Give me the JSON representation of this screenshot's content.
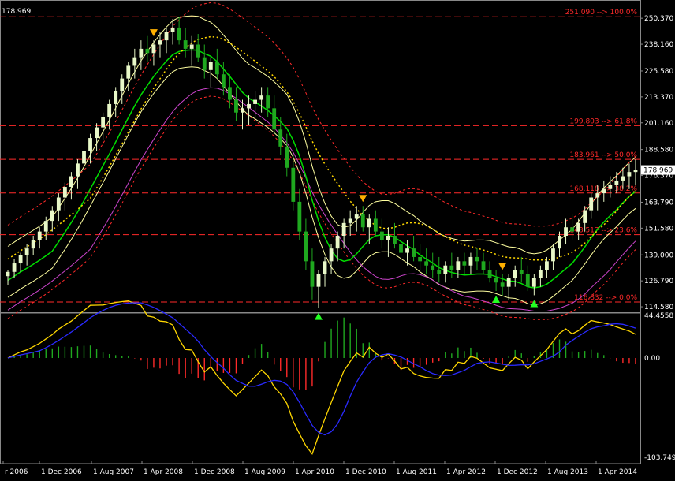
{
  "chart_data": {
    "type": "candlestick",
    "price_axis": {
      "ticks": [
        "250.370",
        "238.160",
        "225.580",
        "213.370",
        "201.160",
        "188.580",
        "176.370",
        "163.790",
        "151.580",
        "139.000",
        "126.790",
        "114.580"
      ],
      "current_price": "178.969",
      "corner_price": "178.969"
    },
    "oscillator_axis": {
      "ticks": [
        "44.4558",
        "0.00",
        "-103.7492"
      ]
    },
    "x_ticks": [
      "r 2006",
      "1 Dec 2006",
      "1 Aug 2007",
      "1 Apr 2008",
      "1 Dec 2008",
      "1 Aug 2009",
      "1 Apr 2010",
      "1 Dec 2010",
      "1 Aug 2011",
      "1 Apr 2012",
      "1 Dec 2012",
      "1 Aug 2013",
      "1 Apr 2014"
    ],
    "fibonacci_levels": [
      {
        "label": "251.090 --> 100.0%",
        "price": 251.09
      },
      {
        "label": "199.803 --> 61.8%",
        "price": 199.803
      },
      {
        "label": "183.961 --> 50.0%",
        "price": 183.961
      },
      {
        "label": "168.118 --> 38.2%",
        "price": 168.118
      },
      {
        "label": "148.517 --> 23.6%",
        "price": 148.517
      },
      {
        "label": "116.832 --> 0.0%",
        "price": 116.832
      }
    ],
    "price_series": [
      [
        0,
        129,
        132,
        125,
        131
      ],
      [
        1,
        131,
        137,
        128,
        135
      ],
      [
        2,
        135,
        140,
        131,
        139
      ],
      [
        3,
        139,
        144,
        134,
        142
      ],
      [
        4,
        142,
        148,
        139,
        146
      ],
      [
        5,
        146,
        152,
        142,
        150
      ],
      [
        6,
        150,
        157,
        146,
        155
      ],
      [
        7,
        155,
        162,
        150,
        160
      ],
      [
        8,
        160,
        168,
        155,
        166
      ],
      [
        9,
        166,
        173,
        160,
        171
      ],
      [
        10,
        171,
        178,
        165,
        176
      ],
      [
        11,
        176,
        184,
        170,
        182
      ],
      [
        12,
        182,
        190,
        176,
        188
      ],
      [
        13,
        188,
        196,
        182,
        194
      ],
      [
        14,
        194,
        201,
        188,
        199
      ],
      [
        15,
        199,
        206,
        193,
        204
      ],
      [
        16,
        204,
        212,
        198,
        210
      ],
      [
        17,
        210,
        218,
        204,
        216
      ],
      [
        18,
        216,
        224,
        210,
        222
      ],
      [
        19,
        222,
        230,
        216,
        228
      ],
      [
        20,
        228,
        236,
        222,
        232
      ],
      [
        21,
        232,
        240,
        226,
        236
      ],
      [
        22,
        236,
        242,
        230,
        234
      ],
      [
        23,
        234,
        240,
        228,
        238
      ],
      [
        24,
        238,
        244,
        232,
        240
      ],
      [
        25,
        240,
        246,
        234,
        244
      ],
      [
        26,
        244,
        250,
        238,
        246
      ],
      [
        27,
        246,
        251,
        238,
        240
      ],
      [
        28,
        240,
        246,
        232,
        236
      ],
      [
        29,
        236,
        242,
        228,
        238
      ],
      [
        30,
        238,
        243,
        230,
        232
      ],
      [
        31,
        232,
        238,
        222,
        226
      ],
      [
        32,
        226,
        232,
        218,
        230
      ],
      [
        33,
        230,
        236,
        222,
        224
      ],
      [
        34,
        224,
        230,
        214,
        218
      ],
      [
        35,
        218,
        224,
        208,
        212
      ],
      [
        36,
        212,
        218,
        202,
        206
      ],
      [
        37,
        206,
        212,
        198,
        208
      ],
      [
        38,
        208,
        214,
        200,
        210
      ],
      [
        39,
        210,
        216,
        204,
        212
      ],
      [
        40,
        212,
        218,
        206,
        214
      ],
      [
        41,
        214,
        218,
        204,
        208
      ],
      [
        42,
        208,
        214,
        196,
        198
      ],
      [
        43,
        198,
        204,
        186,
        190
      ],
      [
        44,
        190,
        196,
        176,
        180
      ],
      [
        45,
        180,
        186,
        160,
        164
      ],
      [
        46,
        164,
        170,
        146,
        150
      ],
      [
        47,
        150,
        156,
        132,
        136
      ],
      [
        48,
        136,
        142,
        118,
        124
      ],
      [
        49,
        124,
        132,
        114,
        130
      ],
      [
        50,
        130,
        138,
        124,
        136
      ],
      [
        51,
        136,
        144,
        130,
        142
      ],
      [
        52,
        142,
        150,
        136,
        148
      ],
      [
        53,
        148,
        156,
        142,
        154
      ],
      [
        54,
        154,
        160,
        148,
        156
      ],
      [
        55,
        156,
        162,
        150,
        158
      ],
      [
        56,
        158,
        162,
        150,
        152
      ],
      [
        57,
        152,
        158,
        144,
        156
      ],
      [
        58,
        156,
        160,
        148,
        150
      ],
      [
        59,
        150,
        156,
        142,
        146
      ],
      [
        60,
        146,
        152,
        138,
        148
      ],
      [
        61,
        148,
        154,
        142,
        144
      ],
      [
        62,
        144,
        150,
        136,
        140
      ],
      [
        63,
        140,
        146,
        134,
        142
      ],
      [
        64,
        142,
        148,
        136,
        138
      ],
      [
        65,
        138,
        144,
        132,
        136
      ],
      [
        66,
        136,
        142,
        130,
        134
      ],
      [
        67,
        134,
        140,
        128,
        132
      ],
      [
        68,
        132,
        138,
        126,
        130
      ],
      [
        69,
        130,
        136,
        126,
        134
      ],
      [
        70,
        134,
        140,
        128,
        132
      ],
      [
        71,
        132,
        138,
        128,
        136
      ],
      [
        72,
        136,
        140,
        130,
        134
      ],
      [
        73,
        134,
        140,
        130,
        138
      ],
      [
        74,
        138,
        142,
        132,
        136
      ],
      [
        75,
        136,
        140,
        130,
        132
      ],
      [
        76,
        132,
        136,
        126,
        128
      ],
      [
        77,
        128,
        132,
        122,
        126
      ],
      [
        78,
        126,
        130,
        120,
        124
      ],
      [
        79,
        124,
        130,
        118,
        128
      ],
      [
        80,
        128,
        134,
        124,
        132
      ],
      [
        81,
        132,
        138,
        126,
        130
      ],
      [
        82,
        130,
        134,
        122,
        124
      ],
      [
        83,
        124,
        130,
        120,
        128
      ],
      [
        84,
        128,
        134,
        124,
        132
      ],
      [
        85,
        132,
        138,
        128,
        136
      ],
      [
        86,
        136,
        144,
        132,
        142
      ],
      [
        87,
        142,
        150,
        138,
        148
      ],
      [
        88,
        148,
        156,
        144,
        152
      ],
      [
        89,
        152,
        158,
        146,
        150
      ],
      [
        90,
        150,
        156,
        146,
        154
      ],
      [
        91,
        154,
        162,
        150,
        160
      ],
      [
        92,
        160,
        168,
        156,
        166
      ],
      [
        93,
        166,
        172,
        160,
        168
      ],
      [
        94,
        168,
        174,
        164,
        170
      ],
      [
        95,
        170,
        176,
        166,
        172
      ],
      [
        96,
        172,
        178,
        168,
        174
      ],
      [
        97,
        174,
        180,
        170,
        176
      ],
      [
        98,
        176,
        182,
        170,
        178
      ],
      [
        99,
        178,
        184,
        172,
        179
      ]
    ],
    "signals": [
      {
        "type": "down",
        "index": 23
      },
      {
        "type": "down",
        "index": 56
      },
      {
        "type": "down",
        "index": 78
      },
      {
        "type": "up",
        "index": 49
      },
      {
        "type": "up",
        "index": 77
      },
      {
        "type": "up",
        "index": 83
      }
    ],
    "colors": {
      "background": "#000000",
      "bull": "#e8f8c8",
      "bear": "#1fa81f",
      "grid": "#333333",
      "fib": "#ff2a2a",
      "ma_green": "#00dd00",
      "ma_yellow": "#ffd700",
      "envelope": "#ffffa0",
      "purple": "#cc44cc",
      "blue": "#2a2aff",
      "hist_pos": "#1fa81f",
      "hist_neg": "#ff2a2a"
    }
  }
}
